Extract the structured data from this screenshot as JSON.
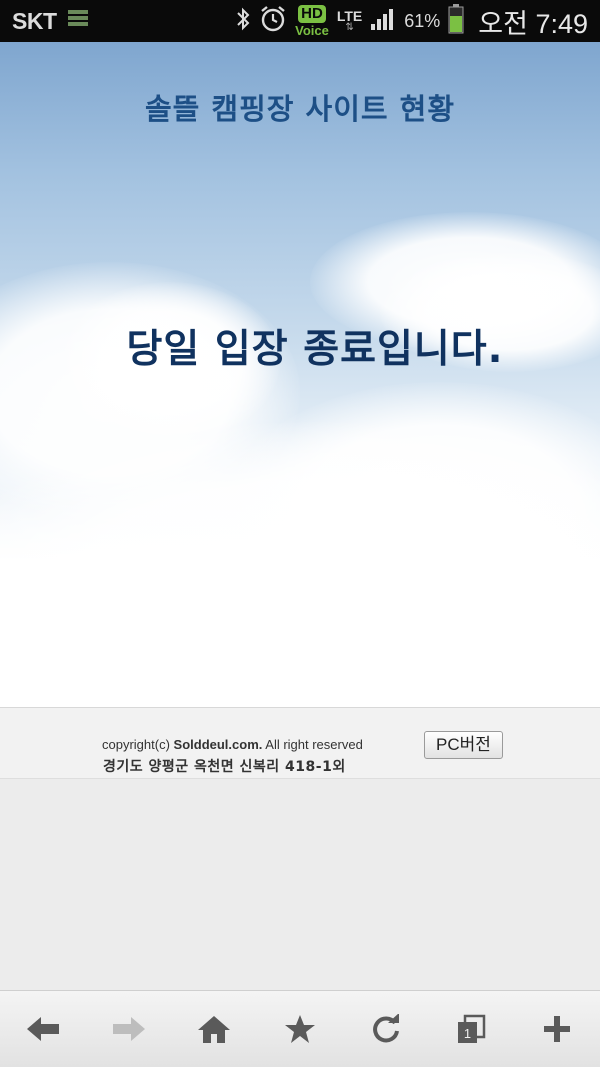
{
  "status_bar": {
    "carrier": "SKT",
    "hd_label": "HD",
    "voice_label": "Voice",
    "network": "LTE",
    "battery_percent": "61%",
    "time": "오전 7:49"
  },
  "page": {
    "site_title": "솔뜰 캠핑장 사이트 현황",
    "status_message": "당일 입장 종료입니다."
  },
  "footer": {
    "copyright_prefix": "copyright(c) ",
    "copyright_brand": "Solddeul.com.",
    "copyright_suffix": " All right reserved",
    "address": "경기도 양평군 옥천면 신복리 418-1외",
    "pc_version_label": "PC버전"
  },
  "browser_nav": {
    "icons": [
      "back-arrow-icon",
      "forward-arrow-icon",
      "home-icon",
      "bookmark-star-icon",
      "refresh-icon",
      "tabs-icon",
      "new-tab-plus-icon"
    ],
    "tab_count": "1"
  },
  "colors": {
    "title": "#1d4f86",
    "message": "#10325f",
    "statusbar_bg": "#0a0a0a",
    "hd_green": "#7bc043"
  }
}
